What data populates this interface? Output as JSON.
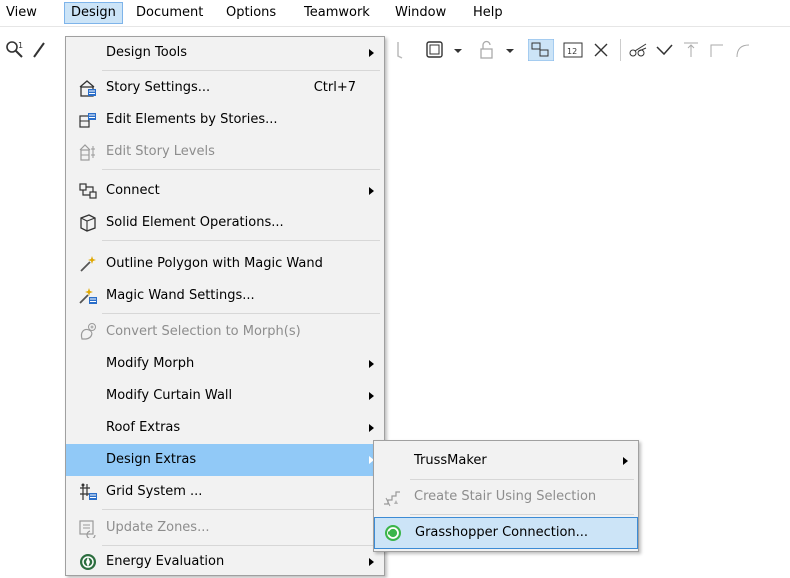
{
  "menubar": {
    "items": [
      "View",
      "Design",
      "Document",
      "Options",
      "Teamwork",
      "Window",
      "Help"
    ]
  },
  "colors": {
    "highlight": "#91c9f7",
    "submenu_highlight": "#cce4f7",
    "submenu_highlight_border": "#3c8bd5",
    "menu_bg": "#f2f2f2",
    "disabled_text": "#8d8d8d"
  },
  "design_menu": {
    "items": [
      {
        "label": "Design Tools",
        "submenu": true,
        "icon": "none"
      },
      {
        "label": "Story Settings...",
        "shortcut": "Ctrl+7",
        "icon": "story-settings-icon"
      },
      {
        "label": "Edit Elements by Stories...",
        "icon": "edit-by-stories-icon"
      },
      {
        "label": "Edit Story Levels",
        "disabled": true,
        "icon": "story-levels-icon"
      },
      {
        "label": "Connect",
        "submenu": true,
        "icon": "connect-icon"
      },
      {
        "label": "Solid Element Operations...",
        "icon": "solid-operations-icon"
      },
      {
        "label": "Outline Polygon with Magic Wand",
        "icon": "magic-wand-icon"
      },
      {
        "label": "Magic Wand Settings...",
        "icon": "magic-wand-settings-icon"
      },
      {
        "label": "Convert Selection to Morph(s)",
        "disabled": true,
        "icon": "morph-icon"
      },
      {
        "label": "Modify Morph",
        "submenu": true,
        "icon": "none"
      },
      {
        "label": "Modify Curtain Wall",
        "submenu": true,
        "icon": "none"
      },
      {
        "label": "Roof Extras",
        "submenu": true,
        "icon": "none"
      },
      {
        "label": "Design Extras",
        "submenu": true,
        "highlighted": true,
        "icon": "none"
      },
      {
        "label": "Grid System ...",
        "icon": "grid-system-icon"
      },
      {
        "label": "Update Zones...",
        "disabled": true,
        "icon": "update-zones-icon"
      },
      {
        "label": "Energy Evaluation",
        "submenu": true,
        "icon": "energy-icon"
      }
    ]
  },
  "design_extras_submenu": {
    "items": [
      {
        "label": "TrussMaker",
        "submenu": true,
        "icon": "none"
      },
      {
        "label": "Create Stair Using Selection",
        "disabled": true,
        "icon": "stair-icon"
      },
      {
        "label": "Grasshopper Connection...",
        "highlighted": true,
        "icon": "grasshopper-icon"
      }
    ]
  }
}
